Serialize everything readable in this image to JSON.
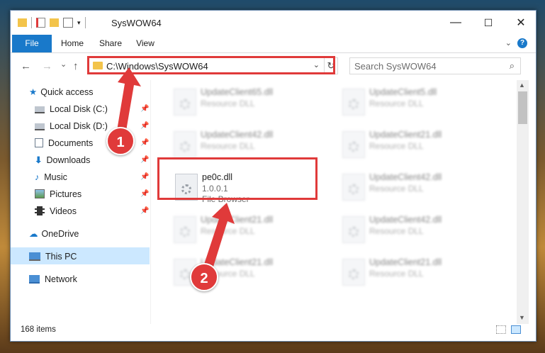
{
  "window": {
    "title": "SysWOW64"
  },
  "window_controls": {
    "minimize": "—",
    "maximize": "☐",
    "close": "✕"
  },
  "ribbon": {
    "tabs": [
      "File",
      "Home",
      "Share",
      "View"
    ],
    "help": "?"
  },
  "nav": {
    "back": "←",
    "forward": "→",
    "recent": "⌄",
    "up": "↑",
    "address": "C:\\Windows\\SysWOW64",
    "search_placeholder": "Search SysWOW64"
  },
  "sidebar": {
    "items": [
      {
        "label": "Quick access",
        "icon": "star-icon"
      },
      {
        "label": "Local Disk (C:)",
        "icon": "drive-icon",
        "pinned": true
      },
      {
        "label": "Local Disk (D:)",
        "icon": "drive-icon",
        "pinned": true
      },
      {
        "label": "Documents",
        "icon": "documents-icon",
        "pinned": true
      },
      {
        "label": "Downloads",
        "icon": "downloads-icon",
        "pinned": true
      },
      {
        "label": "Music",
        "icon": "music-icon",
        "pinned": true
      },
      {
        "label": "Pictures",
        "icon": "pictures-icon",
        "pinned": true
      },
      {
        "label": "Videos",
        "icon": "videos-icon",
        "pinned": true
      },
      {
        "label": "OneDrive",
        "icon": "onedrive-icon"
      },
      {
        "label": "This PC",
        "icon": "computer-icon",
        "selected": true
      },
      {
        "label": "Network",
        "icon": "network-icon"
      }
    ]
  },
  "files": {
    "left": [
      {
        "name": "UpdateClient65.dll",
        "desc": "Resource DLL"
      },
      {
        "name": "UpdateClient42.dll",
        "desc": "Resource DLL"
      },
      {
        "name": "pe0c.dll",
        "version": "1.0.0.1",
        "desc": "File Browser"
      },
      {
        "name": "UpdateClient21.dll",
        "desc": "Resource DLL"
      },
      {
        "name": "UpdateClient21.dll",
        "desc": "Resource DLL"
      }
    ],
    "right": [
      {
        "name": "UpdateClient5.dll",
        "desc": "Resource DLL"
      },
      {
        "name": "UpdateClient21.dll",
        "desc": "Resource DLL"
      },
      {
        "name": "UpdateClient42.dll",
        "desc": "Resource DLL"
      },
      {
        "name": "UpdateClient42.dll",
        "desc": "Resource DLL"
      },
      {
        "name": "UpdateClient21.dll",
        "desc": "Resource DLL"
      }
    ]
  },
  "status": {
    "count": "168 items"
  },
  "annotations": {
    "step1": "1",
    "step2": "2"
  },
  "colors": {
    "accent": "#1979ca",
    "highlight": "#e03a3a",
    "selected_bg": "#cce8ff"
  }
}
